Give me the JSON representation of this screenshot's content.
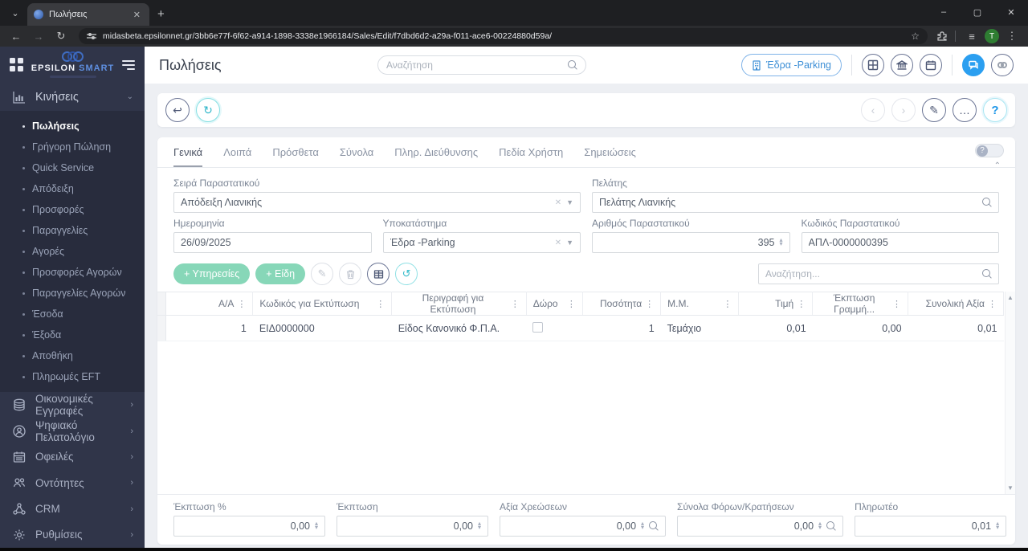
{
  "browser": {
    "tab_title": "Πωλήσεις",
    "url": "midasbeta.epsilonnet.gr/3bb6e77f-6f62-a914-1898-3338e1966184/Sales/Edit/f7dbd6d2-a29a-f011-ace6-00224880d59a/",
    "profile_initial": "T",
    "minimize": "–",
    "maximize": "▢",
    "close": "✕",
    "back": "←",
    "forward": "→",
    "reload": "↻",
    "star": "☆",
    "menu": "⋮",
    "tab_search": "⌄",
    "new_tab": "+",
    "tab_close": "✕",
    "sidebar_list": "≡"
  },
  "colors": {
    "accent_blue": "#2b9ff0",
    "mint_green": "#87d7b8",
    "sidebar_bg": "#303549",
    "submenu_bg": "#282c3d",
    "teal": "#35bccb"
  },
  "sidebar": {
    "brand_primary": "EPSILON",
    "brand_secondary": "SMART",
    "group_label": "Κινήσεις",
    "group_chevron": "⌄",
    "items": [
      {
        "label": "Πωλήσεις",
        "active": true
      },
      {
        "label": "Γρήγορη Πώληση"
      },
      {
        "label": "Quick Service"
      },
      {
        "label": "Απόδειξη"
      },
      {
        "label": "Προσφορές"
      },
      {
        "label": "Παραγγελίες"
      },
      {
        "label": "Αγορές"
      },
      {
        "label": "Προσφορές Αγορών"
      },
      {
        "label": "Παραγγελίες Αγορών"
      },
      {
        "label": "Έσοδα"
      },
      {
        "label": "Έξοδα"
      },
      {
        "label": "Αποθήκη"
      },
      {
        "label": "Πληρωμές EFT"
      }
    ],
    "sections": [
      {
        "label": "Οικονομικές Εγγραφές"
      },
      {
        "label": "Ψηφιακό Πελατολόγιο"
      },
      {
        "label": "Οφειλές"
      },
      {
        "label": "Οντότητες"
      },
      {
        "label": "CRM"
      },
      {
        "label": "Ρυθμίσεις"
      }
    ],
    "section_chevron": "›"
  },
  "header": {
    "title": "Πωλήσεις",
    "search_placeholder": "Αναζήτηση",
    "branch_button": "Έδρα -Parking"
  },
  "toolbar": {
    "back": "↩",
    "refresh": "↻",
    "prev": "‹",
    "next": "›",
    "edit": "✎",
    "more": "…",
    "help": "?"
  },
  "panel": {
    "tabs": [
      {
        "label": "Γενικά",
        "active": true
      },
      {
        "label": "Λοιπά"
      },
      {
        "label": "Πρόσθετα"
      },
      {
        "label": "Σύνολα"
      },
      {
        "label": "Πληρ. Διεύθυνσης"
      },
      {
        "label": "Πεδία Χρήστη"
      },
      {
        "label": "Σημειώσεις"
      }
    ],
    "toggle_glyph": "?",
    "collapse_glyph": "⌃"
  },
  "form": {
    "series": {
      "label": "Σειρά Παραστατικού",
      "value": "Απόδειξη Λιανικής"
    },
    "customer": {
      "label": "Πελάτης",
      "value": "Πελάτης Λιανικής"
    },
    "date": {
      "label": "Ημερομηνία",
      "value": "26/09/2025"
    },
    "branch": {
      "label": "Υποκατάστημα",
      "value": "Έδρα -Parking"
    },
    "doc_no": {
      "label": "Αριθμός Παραστατικού",
      "value": "395"
    },
    "doc_code": {
      "label": "Κωδικός Παραστατικού",
      "value": "ΑΠΛ-0000000395"
    }
  },
  "grid": {
    "btn_services": "+ Υπηρεσίες",
    "btn_items": "+ Είδη",
    "search_placeholder": "Αναζήτηση...",
    "columns": [
      "A/A",
      "Κωδικός για Εκτύπωση",
      "Περιγραφή για Εκτύπωση",
      "Δώρο",
      "Ποσότητα",
      "Μ.Μ.",
      "Τιμή",
      "Έκπτωση Γραμμή...",
      "Συνολική Αξία"
    ],
    "kebab": "⋮",
    "rows": [
      {
        "aa": "1",
        "code": "ΕΙΔ0000000",
        "desc": "Είδος Κανονικό Φ.Π.Α.",
        "gift": false,
        "qty": "1",
        "mm": "Τεμάχιο",
        "price": "0,01",
        "line_discount": "0,00",
        "total": "0,01"
      }
    ]
  },
  "totals": {
    "discount_pct": {
      "label": "Έκπτωση %",
      "value": "0,00"
    },
    "discount": {
      "label": "Έκπτωση",
      "value": "0,00"
    },
    "charges": {
      "label": "Αξία Χρεώσεων",
      "value": "0,00"
    },
    "taxes": {
      "label": "Σύνολα Φόρων/Κρατήσεων",
      "value": "0,00"
    },
    "payable": {
      "label": "Πληρωτέο",
      "value": "0,01"
    }
  }
}
